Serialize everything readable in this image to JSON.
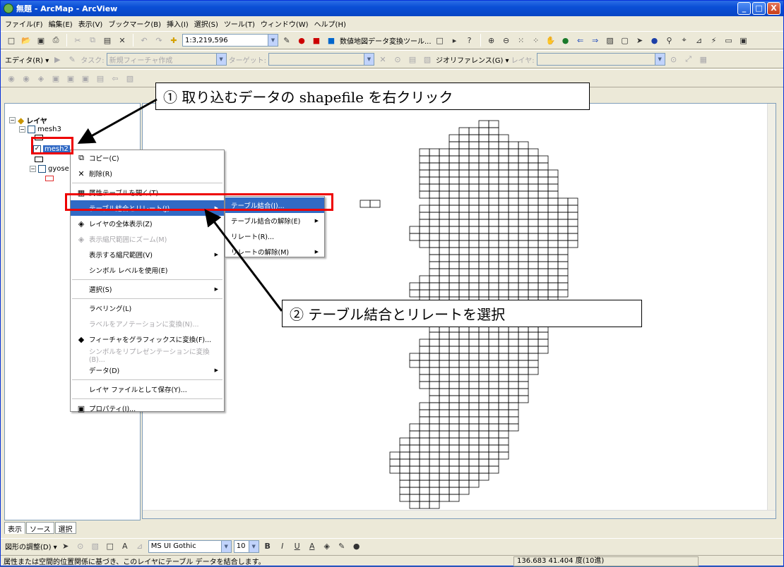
{
  "window": {
    "title": "無題 - ArcMap - ArcView",
    "btn_min": "_",
    "btn_max": "□",
    "btn_close": "X"
  },
  "menus": [
    "ファイル(F)",
    "編集(E)",
    "表示(V)",
    "ブックマーク(B)",
    "挿入(I)",
    "選択(S)",
    "ツール(T)",
    "ウィンドウ(W)",
    "ヘルプ(H)"
  ],
  "toolbar": {
    "scale": "1:3,219,596",
    "converter_label": "数値地図データ変換ツール..."
  },
  "editor": {
    "label": "エディタ(R) ▾",
    "task_label": "タスク:",
    "task_value": "新規フィーチャ作成",
    "target_label": "ターゲット:",
    "georef_label": "ジオリファレンス(G) ▾",
    "layer_label": "レイヤ:"
  },
  "toc": {
    "root": "レイヤ",
    "layers": [
      {
        "name": "mesh3",
        "checked": false
      },
      {
        "name": "mesh2",
        "checked": true
      },
      {
        "name": "gyose",
        "checked": false
      }
    ]
  },
  "context_menu": [
    {
      "label": "コピー(C)",
      "icon": "copy-icon",
      "disabled": false
    },
    {
      "label": "削除(R)",
      "icon": "delete-icon",
      "disabled": false
    },
    {
      "sep": true
    },
    {
      "label": "属性テーブルを開く(T)",
      "icon": "table-icon",
      "disabled": false
    },
    {
      "label": "テーブル結合とリレート(J)",
      "icon": "",
      "disabled": false,
      "highlight": true,
      "submenu": true
    },
    {
      "label": "レイヤの全体表示(Z)",
      "icon": "zoom-layer-icon",
      "disabled": false
    },
    {
      "label": "表示縮尺範囲にズーム(M)",
      "icon": "zoom-scale-icon",
      "disabled": true
    },
    {
      "label": "表示する縮尺範囲(V)",
      "icon": "",
      "disabled": false,
      "submenu": true
    },
    {
      "label": "シンボル レベルを使用(E)",
      "icon": "",
      "disabled": false
    },
    {
      "sep": true
    },
    {
      "label": "選択(S)",
      "icon": "",
      "disabled": false,
      "submenu": true
    },
    {
      "sep": true
    },
    {
      "label": "ラベリング(L)",
      "icon": "",
      "disabled": false
    },
    {
      "label": "ラベルをアノテーションに変換(N)...",
      "icon": "",
      "disabled": true
    },
    {
      "label": "フィーチャをグラフィックスに変換(F)...",
      "icon": "convert-icon",
      "disabled": false
    },
    {
      "label": "シンボルをリプレゼンテーションに変換(B)...",
      "icon": "",
      "disabled": true
    },
    {
      "label": "データ(D)",
      "icon": "",
      "disabled": false,
      "submenu": true
    },
    {
      "sep": true
    },
    {
      "label": "レイヤ ファイルとして保存(Y)...",
      "icon": "",
      "disabled": false
    },
    {
      "sep": true
    },
    {
      "label": "プロパティ(I)...",
      "icon": "properties-icon",
      "disabled": false
    }
  ],
  "submenu": [
    {
      "label": "テーブル結合(J)...",
      "highlight": true
    },
    {
      "label": "テーブル結合の解除(E)",
      "submenu": true
    },
    {
      "label": "リレート(R)..."
    },
    {
      "label": "リレートの解除(M)",
      "submenu": true
    }
  ],
  "callouts": {
    "c1": "① 取り込むデータの shapefile を右クリック",
    "c2": "② テーブル結合とリレートを選択"
  },
  "tabs": [
    "表示",
    "ソース",
    "選択"
  ],
  "drawing": {
    "label": "図形の調整(D) ▾",
    "font": "MS UI Gothic",
    "size": "10"
  },
  "status": {
    "message": "属性または空間的位置関係に基づき、このレイヤにテーブル データを結合します。",
    "coords": "136.683  41.404 度(10進)"
  },
  "colors": {
    "highlight": "#316ac5",
    "annotation_red": "#ee0000",
    "title_blue": "#0a4fd6"
  }
}
